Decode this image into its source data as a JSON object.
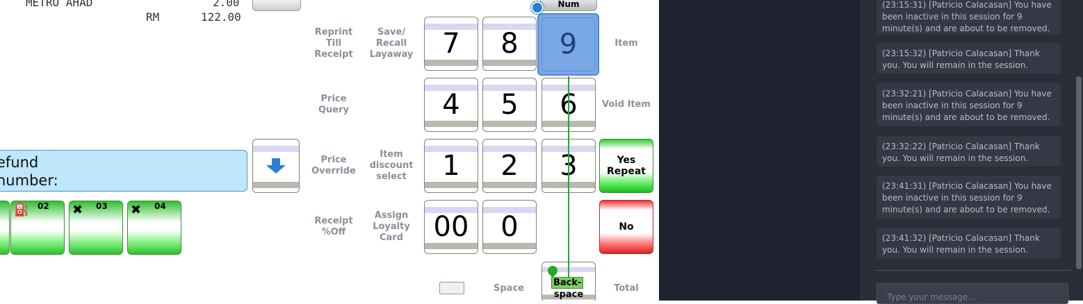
{
  "receipt": {
    "item_name": "METRO AHAD",
    "item_qty": "2.00",
    "currency": "RM",
    "total": "122.00"
  },
  "message_box": {
    "line1": "efund",
    "line2": "number:"
  },
  "tenders": [
    {
      "label": "02"
    },
    {
      "label": "03"
    },
    {
      "label": "04"
    }
  ],
  "keypad": {
    "num_label": "Num",
    "keys": [
      "7",
      "8",
      "9",
      "4",
      "5",
      "6",
      "1",
      "2",
      "3",
      "00",
      "0",
      "."
    ],
    "yes": "Yes Repeat",
    "no": "No",
    "backspace_tag": "Back-",
    "backspace_rest": "space"
  },
  "function_labels": {
    "reprint": "Reprint Till Receipt",
    "save_recall": "Save/ Recall Layaway",
    "price_query": "Price Query",
    "price_override": "Price Override",
    "item_discount": "Item discount select",
    "receipt_off": "Receipt %Off",
    "assign_loyalty": "Assign Loyalty Card",
    "item": "Item",
    "void_item": "Void Item",
    "space": "Space",
    "total": "Total"
  },
  "chat": {
    "messages": [
      {
        "text": "(23:15:31) [Patricio Calacasan] You have been inactive in this session for 9 minute(s) and are about to be removed."
      },
      {
        "text": "(23:15:32) [Patricio Calacasan] Thank you. You will remain in the session."
      },
      {
        "text": "(23:32:21) [Patricio Calacasan] You have been inactive in this session for 9 minute(s) and are about to be removed."
      },
      {
        "text": "(23:32:22) [Patricio Calacasan] Thank you. You will remain in the session."
      },
      {
        "text": "(23:41:31) [Patricio Calacasan] You have been inactive in this session for 9 minute(s) and are about to be removed."
      },
      {
        "text": "(23:41:32) [Patricio Calacasan] Thank you. You will remain in the session."
      }
    ],
    "input_placeholder": "Type your message..."
  }
}
